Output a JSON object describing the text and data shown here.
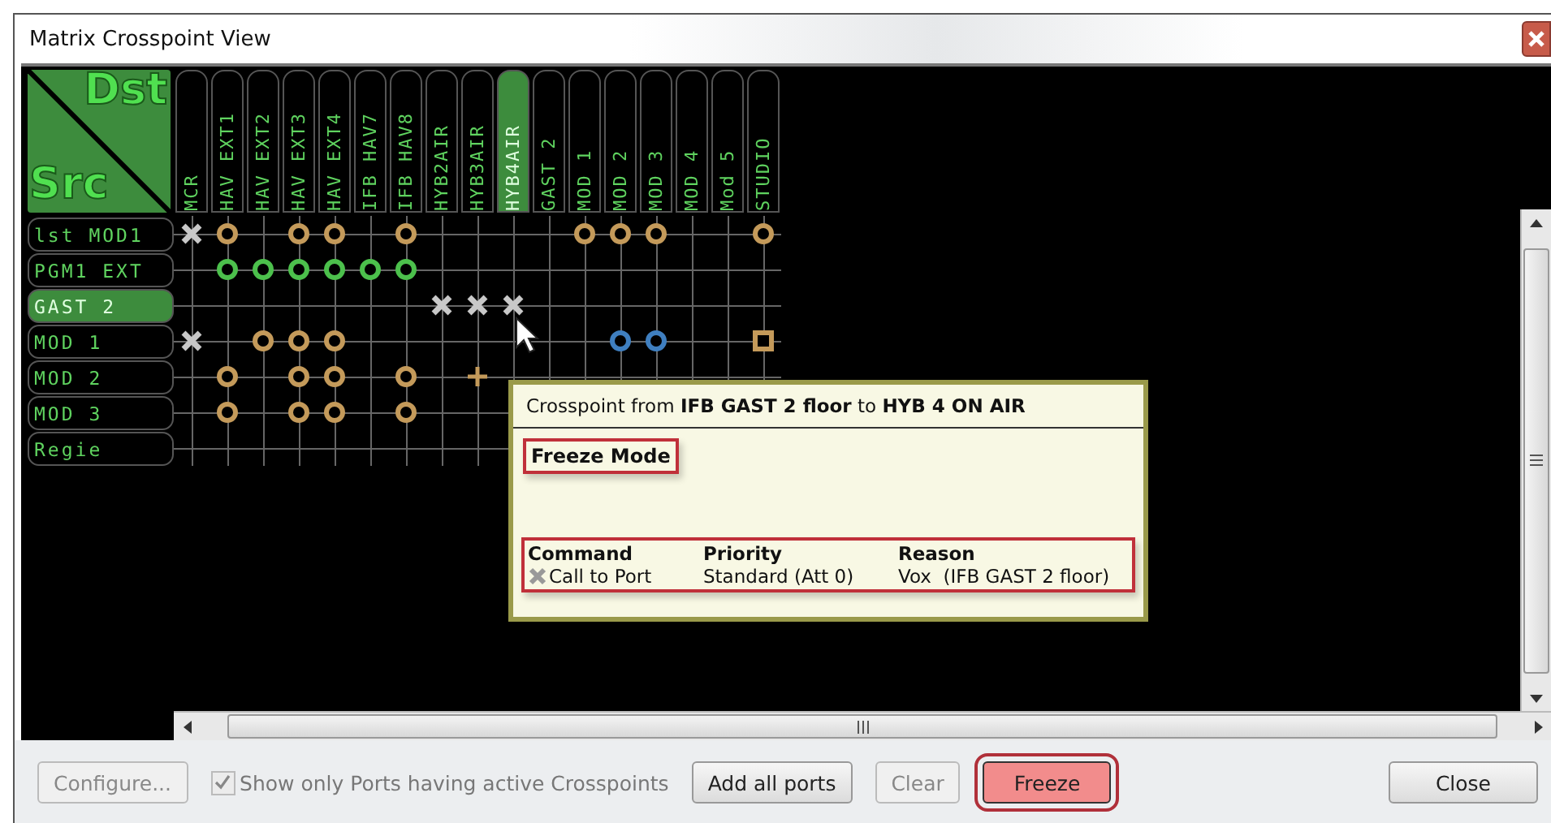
{
  "window": {
    "title": "Matrix Crosspoint View"
  },
  "corner": {
    "dst": "Dst",
    "src": "Src"
  },
  "columns": [
    {
      "label": "MCR",
      "selected": false
    },
    {
      "label": "HAV EXT1",
      "selected": false
    },
    {
      "label": "HAV EXT2",
      "selected": false
    },
    {
      "label": "HAV EXT3",
      "selected": false
    },
    {
      "label": "HAV EXT4",
      "selected": false
    },
    {
      "label": "IFB HAV7",
      "selected": false
    },
    {
      "label": "IFB HAV8",
      "selected": false
    },
    {
      "label": "HYB2AIR",
      "selected": false
    },
    {
      "label": "HYB3AIR",
      "selected": false
    },
    {
      "label": "HYB4AIR",
      "selected": true
    },
    {
      "label": "GAST 2",
      "selected": false
    },
    {
      "label": "MOD 1",
      "selected": false
    },
    {
      "label": "MOD 2",
      "selected": false
    },
    {
      "label": "MOD 3",
      "selected": false
    },
    {
      "label": "MOD 4",
      "selected": false
    },
    {
      "label": "Mod 5",
      "selected": false
    },
    {
      "label": "STUDIO",
      "selected": false
    }
  ],
  "rows": [
    {
      "label": "lst MOD1",
      "selected": false,
      "cells": [
        {
          "kind": "cross",
          "color": "#c8c8c8"
        },
        {
          "kind": "circle",
          "color": "#c49a5a"
        },
        {
          "kind": "none"
        },
        {
          "kind": "circle",
          "color": "#c49a5a"
        },
        {
          "kind": "circle",
          "color": "#c49a5a"
        },
        {
          "kind": "none"
        },
        {
          "kind": "circle",
          "color": "#c49a5a"
        },
        {
          "kind": "none"
        },
        {
          "kind": "none"
        },
        {
          "kind": "none"
        },
        {
          "kind": "none"
        },
        {
          "kind": "circle",
          "color": "#c49a5a"
        },
        {
          "kind": "circle",
          "color": "#c49a5a"
        },
        {
          "kind": "circle",
          "color": "#c49a5a"
        },
        {
          "kind": "none"
        },
        {
          "kind": "none"
        },
        {
          "kind": "circle",
          "color": "#c49a5a"
        }
      ]
    },
    {
      "label": "PGM1 EXT",
      "selected": false,
      "cells": [
        {
          "kind": "none"
        },
        {
          "kind": "circle",
          "color": "#4cc04c"
        },
        {
          "kind": "circle",
          "color": "#4cc04c"
        },
        {
          "kind": "circle",
          "color": "#4cc04c"
        },
        {
          "kind": "circle",
          "color": "#4cc04c"
        },
        {
          "kind": "circle",
          "color": "#4cc04c"
        },
        {
          "kind": "circle",
          "color": "#4cc04c"
        },
        {
          "kind": "none"
        },
        {
          "kind": "none"
        },
        {
          "kind": "none"
        },
        {
          "kind": "none"
        },
        {
          "kind": "none"
        },
        {
          "kind": "none"
        },
        {
          "kind": "none"
        },
        {
          "kind": "none"
        },
        {
          "kind": "none"
        },
        {
          "kind": "none"
        }
      ]
    },
    {
      "label": "GAST 2",
      "selected": true,
      "cells": [
        {
          "kind": "none"
        },
        {
          "kind": "none"
        },
        {
          "kind": "none"
        },
        {
          "kind": "none"
        },
        {
          "kind": "none"
        },
        {
          "kind": "none"
        },
        {
          "kind": "none"
        },
        {
          "kind": "cross",
          "color": "#c8c8c8"
        },
        {
          "kind": "cross",
          "color": "#c8c8c8"
        },
        {
          "kind": "cross",
          "color": "#c8c8c8"
        },
        {
          "kind": "none"
        },
        {
          "kind": "none"
        },
        {
          "kind": "none"
        },
        {
          "kind": "none"
        },
        {
          "kind": "none"
        },
        {
          "kind": "none"
        },
        {
          "kind": "none"
        }
      ]
    },
    {
      "label": "MOD 1",
      "selected": false,
      "cells": [
        {
          "kind": "cross",
          "color": "#c8c8c8"
        },
        {
          "kind": "none"
        },
        {
          "kind": "circle",
          "color": "#c49a5a"
        },
        {
          "kind": "circle",
          "color": "#c49a5a"
        },
        {
          "kind": "circle",
          "color": "#c49a5a"
        },
        {
          "kind": "none"
        },
        {
          "kind": "none"
        },
        {
          "kind": "none"
        },
        {
          "kind": "none"
        },
        {
          "kind": "none"
        },
        {
          "kind": "none"
        },
        {
          "kind": "none"
        },
        {
          "kind": "circle",
          "color": "#3f7fc0"
        },
        {
          "kind": "circle",
          "color": "#3f7fc0"
        },
        {
          "kind": "none"
        },
        {
          "kind": "none"
        },
        {
          "kind": "square",
          "color": "#c49a5a"
        }
      ]
    },
    {
      "label": "MOD 2",
      "selected": false,
      "cells": [
        {
          "kind": "none"
        },
        {
          "kind": "circle",
          "color": "#c49a5a"
        },
        {
          "kind": "none"
        },
        {
          "kind": "circle",
          "color": "#c49a5a"
        },
        {
          "kind": "circle",
          "color": "#c49a5a"
        },
        {
          "kind": "none"
        },
        {
          "kind": "circle",
          "color": "#c49a5a"
        },
        {
          "kind": "none"
        },
        {
          "kind": "plus",
          "color": "#c49a5a"
        },
        {
          "kind": "none"
        },
        {
          "kind": "none"
        },
        {
          "kind": "none"
        },
        {
          "kind": "none"
        },
        {
          "kind": "none"
        },
        {
          "kind": "none"
        },
        {
          "kind": "none"
        },
        {
          "kind": "none"
        }
      ]
    },
    {
      "label": "MOD 3",
      "selected": false,
      "cells": [
        {
          "kind": "none"
        },
        {
          "kind": "circle",
          "color": "#c49a5a"
        },
        {
          "kind": "none"
        },
        {
          "kind": "circle",
          "color": "#c49a5a"
        },
        {
          "kind": "circle",
          "color": "#c49a5a"
        },
        {
          "kind": "none"
        },
        {
          "kind": "circle",
          "color": "#c49a5a"
        },
        {
          "kind": "none"
        },
        {
          "kind": "none"
        },
        {
          "kind": "none"
        },
        {
          "kind": "none"
        },
        {
          "kind": "none"
        },
        {
          "kind": "none"
        },
        {
          "kind": "none"
        },
        {
          "kind": "none"
        },
        {
          "kind": "none"
        },
        {
          "kind": "none"
        }
      ]
    },
    {
      "label": "Regie",
      "selected": false,
      "cells": [
        {
          "kind": "none"
        },
        {
          "kind": "none"
        },
        {
          "kind": "none"
        },
        {
          "kind": "none"
        },
        {
          "kind": "none"
        },
        {
          "kind": "none"
        },
        {
          "kind": "none"
        },
        {
          "kind": "none"
        },
        {
          "kind": "none"
        },
        {
          "kind": "none"
        },
        {
          "kind": "none"
        },
        {
          "kind": "none"
        },
        {
          "kind": "none"
        },
        {
          "kind": "none"
        },
        {
          "kind": "none"
        },
        {
          "kind": "none"
        },
        {
          "kind": "none"
        }
      ]
    }
  ],
  "tooltip": {
    "title": "Crosspoint from **IFB GAST 2 floor** to **HYB 4 ON AIR**",
    "mode": "Freeze Mode",
    "mode_highlighted": true,
    "table_highlighted": true,
    "columns": [
      "Command",
      "Priority",
      "Reason"
    ],
    "rows": [
      {
        "command": "Call to Port",
        "priority": "Standard (Att 0)",
        "reason": "Vox  (IFB GAST 2 floor)"
      }
    ]
  },
  "footer": {
    "buttons": [
      {
        "label": "Configure...",
        "disabled": true,
        "highlighted": false
      },
      {
        "label": "Add all ports",
        "disabled": false,
        "highlighted": false
      },
      {
        "label": "Clear",
        "disabled": true,
        "highlighted": false
      },
      {
        "label": "Freeze",
        "disabled": false,
        "highlighted": true
      },
      {
        "label": "Close",
        "disabled": false,
        "highlighted": false
      }
    ],
    "checkbox": {
      "label": "Show only Ports having active Crosspoints",
      "checked": true,
      "disabled": true
    }
  }
}
